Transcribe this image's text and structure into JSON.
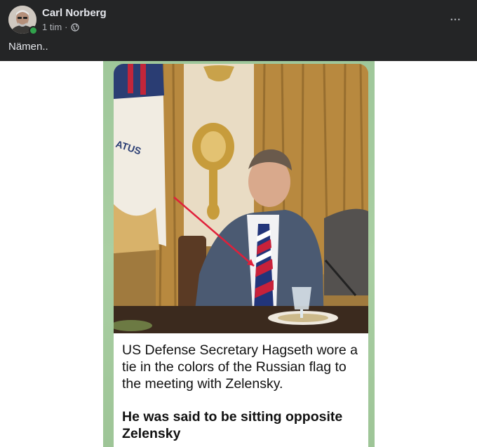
{
  "post": {
    "author": "Carl Norberg",
    "time": "1 tim",
    "separator": "·",
    "privacy_icon": "globe-icon",
    "more_icon": "more-horizontal-icon",
    "more_label": "•••",
    "text": "Nämen.."
  },
  "image": {
    "flag_text": "ATUS",
    "caption": "US Defense Secretary Hagseth wore a tie in the colors of the Russian flag to the meeting with Zelensky.",
    "caption_bold": "He was said to be sitting opposite Zelensky"
  },
  "colors": {
    "header_bg": "#242526",
    "primary_text": "#e4e6eb",
    "secondary_text": "#b0b3b8",
    "online": "#31a24c",
    "frame_green": "#a6cca0",
    "arrow_red": "#e0203a"
  }
}
